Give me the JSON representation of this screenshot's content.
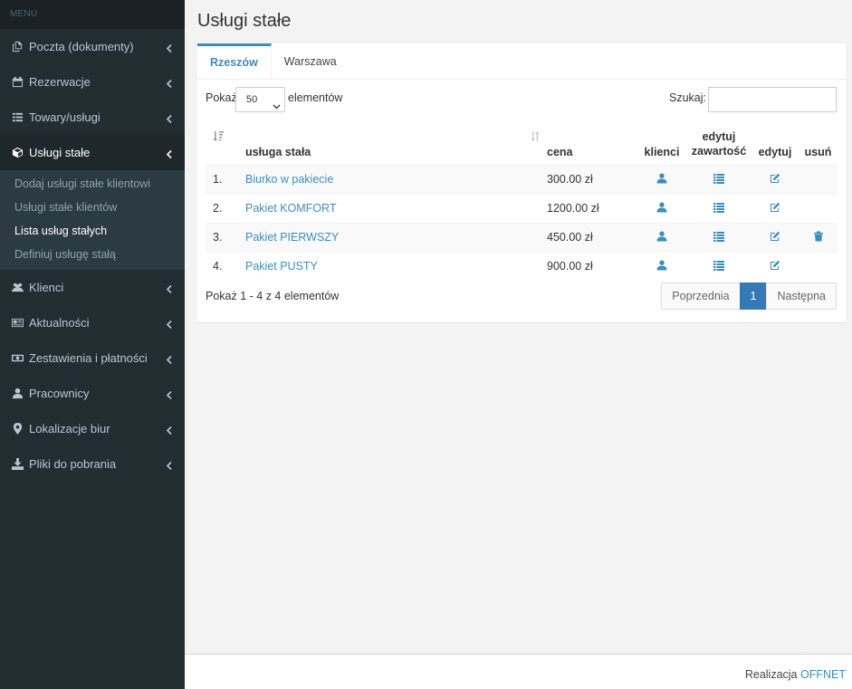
{
  "sidebar": {
    "header": "MENU",
    "items": [
      {
        "label": "Poczta (dokumenty)",
        "icon": "copy-icon"
      },
      {
        "label": "Rezerwacje",
        "icon": "calendar-icon"
      },
      {
        "label": "Towary/usługi",
        "icon": "list-icon"
      },
      {
        "label": "Usługi stałe",
        "icon": "cube-icon"
      },
      {
        "label": "Klienci",
        "icon": "users-icon"
      },
      {
        "label": "Aktualności",
        "icon": "newspaper-icon"
      },
      {
        "label": "Zestawienia i płatności",
        "icon": "money-icon"
      },
      {
        "label": "Pracownicy",
        "icon": "user-icon"
      },
      {
        "label": "Lokalizacje biur",
        "icon": "map-marker-icon"
      },
      {
        "label": "Pliki do pobrania",
        "icon": "download-icon"
      }
    ],
    "submenu": [
      "Dodaj usługi stałe klientowi",
      "Usługi stałe klientów",
      "Lista usług stałych",
      "Definiuj usługę stałą"
    ]
  },
  "page": {
    "title": "Usługi stałe",
    "tabs": [
      "Rzeszów",
      "Warszawa"
    ],
    "show_label": "Pokaż",
    "page_size": "50",
    "show_after": "elementów",
    "search_label": "Szukaj:",
    "search_value": "",
    "columns": {
      "service": "usługa stała",
      "price": "cena",
      "clients": "klienci",
      "edit_content_1": "edytuj",
      "edit_content_2": "zawartość",
      "edit": "edytuj",
      "delete": "usuń"
    },
    "rows": [
      {
        "num": "1.",
        "name": "Biurko w pakiecie",
        "price": "300.00 zł",
        "deletable": false
      },
      {
        "num": "2.",
        "name": "Pakiet KOMFORT",
        "price": "1200.00 zł",
        "deletable": false
      },
      {
        "num": "3.",
        "name": "Pakiet PIERWSZY",
        "price": "450.00 zł",
        "deletable": true
      },
      {
        "num": "4.",
        "name": "Pakiet PUSTY",
        "price": "900.00 zł",
        "deletable": false
      }
    ],
    "info": "Pokaż 1 - 4 z 4 elementów",
    "pagination": {
      "prev": "Poprzednia",
      "current": "1",
      "next": "Następna"
    }
  },
  "footer": {
    "text": "Realizacja",
    "link": "OFFNET"
  },
  "colors": {
    "sidebar_bg": "#222d32",
    "accent": "#3c8dbc",
    "active_page": "#337ab7"
  }
}
